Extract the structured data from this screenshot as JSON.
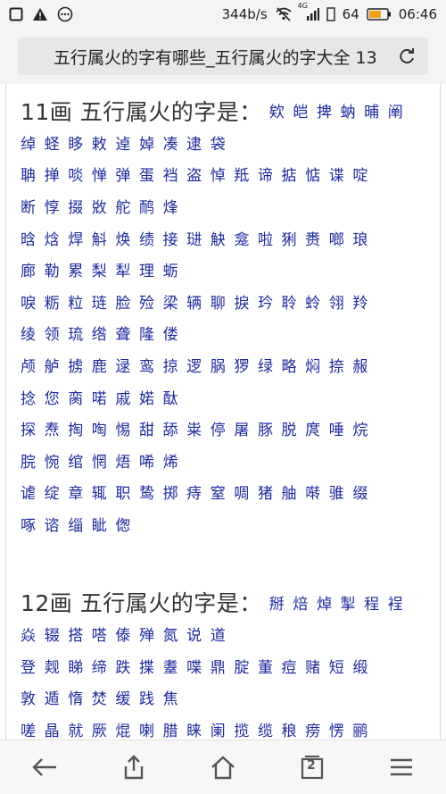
{
  "status_bar": {
    "speed": "344b/s",
    "network_badge": "4G",
    "battery": "64",
    "time": "06:46"
  },
  "address_bar": {
    "title": "五行属火的字有哪些_五行属火的字大全 13"
  },
  "sections": [
    {
      "heading": "11画 五行属火的字是：",
      "rows": [
        [
          "欸",
          "皑",
          "捭",
          "蚋",
          "晡",
          "阐"
        ],
        [
          "绰",
          "蛏",
          "眵",
          "敕",
          "逴",
          "婥",
          "凑",
          "逮",
          "袋"
        ],
        [
          "聃",
          "掸",
          "啖",
          "惮",
          "弹",
          "蛋",
          "裆",
          "盗",
          "悼",
          "羝",
          "谛",
          "掂",
          "惦",
          "谍",
          "啶"
        ],
        [
          "断",
          "惇",
          "掇",
          "敚",
          "舵",
          "鸸",
          "烽"
        ],
        [
          "晗",
          "焓",
          "焊",
          "斛",
          "焕",
          "绩",
          "接",
          "琎",
          "觖",
          "龛",
          "啦",
          "猁",
          "赉",
          "啷",
          "琅"
        ],
        [
          "廊",
          "勒",
          "累",
          "梨",
          "犁",
          "理",
          "蛎"
        ],
        [
          "唳",
          "粝",
          "粒",
          "琏",
          "脸",
          "殓",
          "梁",
          "辆",
          "聊",
          "捩",
          "玪",
          "聆",
          "蛉",
          "翎",
          "羚"
        ],
        [
          "绫",
          "领",
          "琉",
          "绺",
          "聋",
          "隆",
          "偻"
        ],
        [
          "颅",
          "舻",
          "掳",
          "鹿",
          "逯",
          "鸾",
          "掠",
          "逻",
          "脶",
          "猡",
          "绿",
          "略",
          "焖",
          "捺",
          "赧"
        ],
        [
          "捻",
          "您",
          "脔",
          "喏",
          "戚",
          "婼",
          "酞"
        ],
        [
          "探",
          "焘",
          "掏",
          "啕",
          "惕",
          "甜",
          "舔",
          "粜",
          "停",
          "屠",
          "豚",
          "脱",
          "庹",
          "唾",
          "烷"
        ],
        [
          "脘",
          "惋",
          "绾",
          "惘",
          "焐",
          "唏",
          "烯"
        ],
        [
          "谑",
          "绽",
          "章",
          "辄",
          "职",
          "鸷",
          "掷",
          "痔",
          "窒",
          "啁",
          "猪",
          "舳",
          "啭",
          "骓",
          "缀"
        ],
        [
          "啄",
          "谘",
          "缁",
          "眦",
          "偬"
        ]
      ]
    },
    {
      "heading": "12画 五行属火的字是：",
      "rows": [
        [
          "掰",
          "焙",
          "焯",
          "掣",
          "程",
          "裎"
        ],
        [
          "焱",
          "辍",
          "搭",
          "嗒",
          "傣",
          "殚",
          "氮",
          "说",
          "道"
        ],
        [
          "登",
          "觌",
          "睇",
          "缔",
          "跌",
          "揲",
          "耋",
          "喋",
          "鼎",
          "腚",
          "董",
          "痘",
          "赌",
          "短",
          "缎"
        ],
        [
          "敦",
          "遁",
          "惰",
          "焚",
          "缓",
          "践",
          "焦"
        ],
        [
          "嗟",
          "晶",
          "就",
          "厥",
          "焜",
          "喇",
          "腊",
          "睐",
          "阑",
          "揽",
          "缆",
          "稂",
          "痨",
          "愣",
          "鹂"
        ]
      ]
    }
  ],
  "bottom_nav": {
    "tab_count": "2"
  },
  "colors": {
    "char_link": "#1f2a9c",
    "heading": "#333333",
    "bar_bg": "#f4f4f4"
  }
}
